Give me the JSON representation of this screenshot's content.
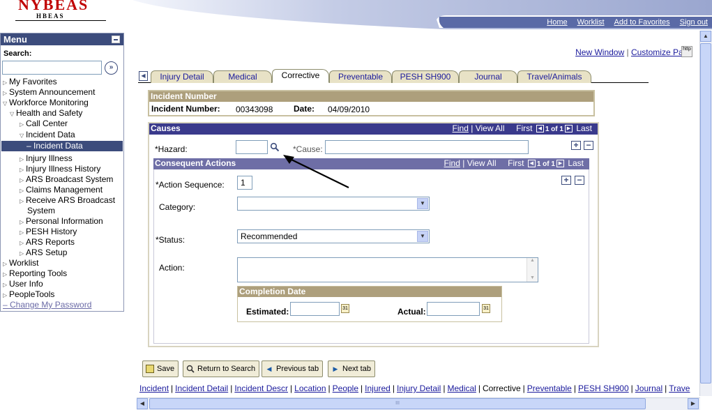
{
  "logo": {
    "name": "NYBEAS",
    "sub": "HBEAS"
  },
  "header": {
    "links": [
      "Home",
      "Worklist",
      "Add to Favorites",
      "Sign out"
    ]
  },
  "menu": {
    "title": "Menu",
    "search_label": "Search:",
    "search_go": "»",
    "items": [
      "My Favorites",
      "System Announcement",
      "Workforce Monitoring",
      "Health and Safety",
      "Call Center",
      "Incident Data",
      "– Incident Data",
      "Injury Illness",
      "Injury Illness History",
      "ARS Broadcast System",
      "Claims Management",
      "Receive ARS Broadcast",
      "System",
      "Personal Information",
      "PESH History",
      "ARS Reports",
      "ARS Setup",
      "Worklist",
      "Reporting Tools",
      "User Info",
      "PeopleTools",
      "– Change My Password"
    ]
  },
  "page_links": {
    "new_window": "New Window",
    "customize": "Customize Page",
    "http": "http"
  },
  "tabs": [
    "Injury Detail",
    "Medical",
    "Corrective",
    "Preventable",
    "PESH SH900",
    "Journal",
    "Travel/Animals"
  ],
  "incident": {
    "heading": "Incident Number",
    "number_label": "Incident Number:",
    "number": "00343098",
    "date_label": "Date:",
    "date": "04/09/2010"
  },
  "causes": {
    "title": "Causes",
    "find": "Find",
    "view_all": "View All",
    "first": "First",
    "count": "1 of 1",
    "last": "Last",
    "hazard_label": "*Hazard:",
    "hazard_value": "",
    "cause_label": "*Cause:",
    "cause_value": ""
  },
  "consequent": {
    "title": "Consequent Actions",
    "find": "Find",
    "view_all": "View All",
    "first": "First",
    "count": "1 of 1",
    "last": "Last",
    "seq_label": "*Action Sequence:",
    "seq_value": "1",
    "category_label": "Category:",
    "category_value": "",
    "status_label": "*Status:",
    "status_value": "Recommended",
    "action_label": "Action:",
    "action_value": "",
    "completion_title": "Completion Date",
    "estimated_label": "Estimated:",
    "estimated_value": "",
    "actual_label": "Actual:",
    "actual_value": "",
    "cal_text": "31"
  },
  "buttons": {
    "save": "Save",
    "return": "Return to Search",
    "previous": "Previous tab",
    "next": "Next tab"
  },
  "bottom_links": [
    "Incident",
    "Incident Detail",
    "Incident Descr",
    "Location",
    "People",
    "Injured",
    "Injury Detail",
    "Medical",
    "Corrective",
    "Preventable",
    "PESH SH900",
    "Journal",
    "Trave"
  ],
  "scroll_glyph": "III",
  "colors": {
    "menu_header": "#3c4c7c",
    "tab_bg": "#e8e2c6",
    "box_header": "#ad9f7c",
    "bar_blue": "#3a3a8c",
    "bar_purple": "#6e6ea6"
  }
}
